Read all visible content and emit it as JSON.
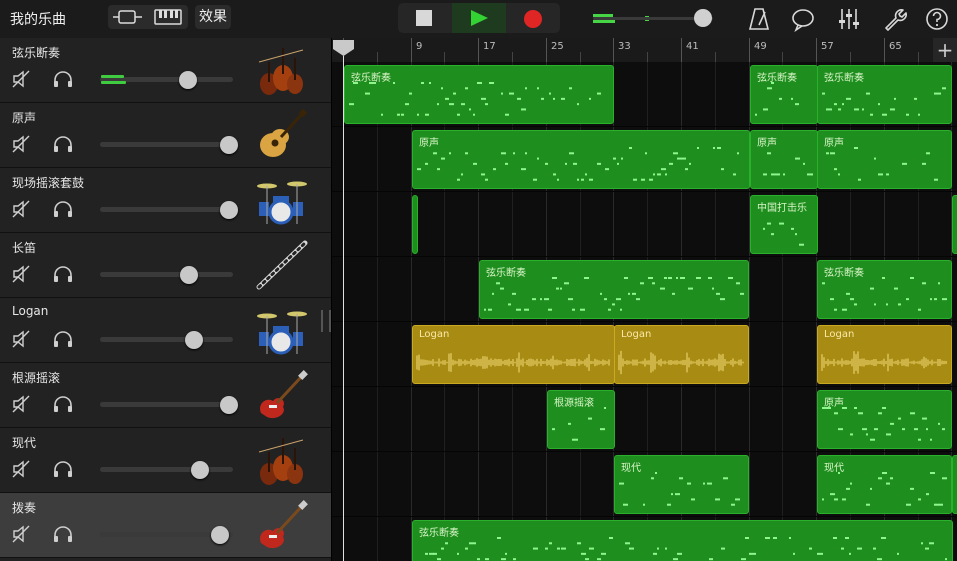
{
  "app": {
    "song_title": "我的乐曲",
    "effects_label": "效果"
  },
  "colors": {
    "accent_green": "#34d334",
    "record_red": "#e02525",
    "region_green": "#1e8e1e",
    "region_gold": "#a88b12"
  },
  "icons": {
    "tracks_view": "tracks-view-icon",
    "keyboard": "keyboard-icon",
    "stop": "stop-icon",
    "play": "play-icon",
    "record": "record-icon",
    "metronome": "metronome-icon",
    "loop": "loop-browser-icon",
    "mixer": "mixer-icon",
    "settings": "wrench-icon",
    "help": "help-icon",
    "add_track": "plus-icon"
  },
  "master_volume": 0.92,
  "ruler": {
    "labels": [
      "1",
      "9",
      "17",
      "25",
      "33",
      "41",
      "49",
      "57",
      "65"
    ],
    "add_label": "+"
  },
  "tracks": [
    {
      "name": "弦乐断奏",
      "volume": 0.66,
      "meter": 0.17,
      "instrument": "strings"
    },
    {
      "name": "原声",
      "volume": 0.97,
      "meter": 0,
      "instrument": "acoustic-guitar"
    },
    {
      "name": "现场摇滚套鼓",
      "volume": 0.97,
      "meter": 0,
      "instrument": "drum-kit"
    },
    {
      "name": "长笛",
      "volume": 0.67,
      "meter": 0,
      "instrument": "flute"
    },
    {
      "name": "Logan",
      "volume": 0.71,
      "meter": 0,
      "instrument": "drum-kit"
    },
    {
      "name": "根源摇滚",
      "volume": 0.97,
      "meter": 0,
      "instrument": "electric-guitar"
    },
    {
      "name": "现代",
      "volume": 0.75,
      "meter": 0,
      "instrument": "strings"
    },
    {
      "name": "拨奏",
      "volume": 0.9,
      "meter": 0,
      "instrument": "electric-guitar",
      "selected": true
    }
  ],
  "regions": [
    {
      "track": 0,
      "start": 1,
      "end": 33,
      "label": "弦乐断奏",
      "kind": "midi",
      "color": "green"
    },
    {
      "track": 0,
      "start": 49,
      "end": 57,
      "label": "弦乐断奏",
      "kind": "midi",
      "color": "green"
    },
    {
      "track": 0,
      "start": 57,
      "end": 73,
      "label": "弦乐断奏",
      "kind": "midi",
      "color": "green"
    },
    {
      "track": 1,
      "start": 9,
      "end": 49,
      "label": "原声",
      "kind": "midi",
      "color": "green"
    },
    {
      "track": 1,
      "start": 49,
      "end": 57,
      "label": "原声",
      "kind": "midi",
      "color": "green"
    },
    {
      "track": 1,
      "start": 57,
      "end": 73,
      "label": "原声",
      "kind": "midi",
      "color": "green"
    },
    {
      "track": 2,
      "start": 9,
      "end": 9.4,
      "label": "",
      "kind": "midi",
      "color": "green"
    },
    {
      "track": 2,
      "start": 49,
      "end": 57,
      "label": "中国打击乐",
      "kind": "midi",
      "color": "green"
    },
    {
      "track": 2,
      "start": 73,
      "end": 74.2,
      "label": "",
      "kind": "midi",
      "color": "green"
    },
    {
      "track": 3,
      "start": 17,
      "end": 49,
      "label": "弦乐断奏",
      "kind": "midi",
      "color": "green"
    },
    {
      "track": 3,
      "start": 57,
      "end": 73,
      "label": "弦乐断奏",
      "kind": "midi",
      "color": "green"
    },
    {
      "track": 4,
      "start": 9,
      "end": 33,
      "label": "Logan",
      "kind": "audio",
      "color": "gold"
    },
    {
      "track": 4,
      "start": 33,
      "end": 49,
      "label": "Logan",
      "kind": "audio",
      "color": "gold"
    },
    {
      "track": 4,
      "start": 57,
      "end": 73,
      "label": "Logan",
      "kind": "audio",
      "color": "gold"
    },
    {
      "track": 5,
      "start": 25,
      "end": 33,
      "label": "根源摇滚",
      "kind": "midi",
      "color": "green"
    },
    {
      "track": 5,
      "start": 57,
      "end": 73,
      "label": "原声",
      "kind": "midi",
      "color": "green"
    },
    {
      "track": 6,
      "start": 33,
      "end": 49,
      "label": "现代",
      "kind": "midi",
      "color": "green"
    },
    {
      "track": 6,
      "start": 57,
      "end": 73,
      "label": "现代",
      "kind": "midi",
      "color": "green"
    },
    {
      "track": 6,
      "start": 73,
      "end": 74.2,
      "label": "",
      "kind": "midi",
      "color": "green"
    },
    {
      "track": 7,
      "start": 9,
      "end": 73,
      "label": "弦乐断奏",
      "kind": "midi",
      "color": "green"
    }
  ]
}
